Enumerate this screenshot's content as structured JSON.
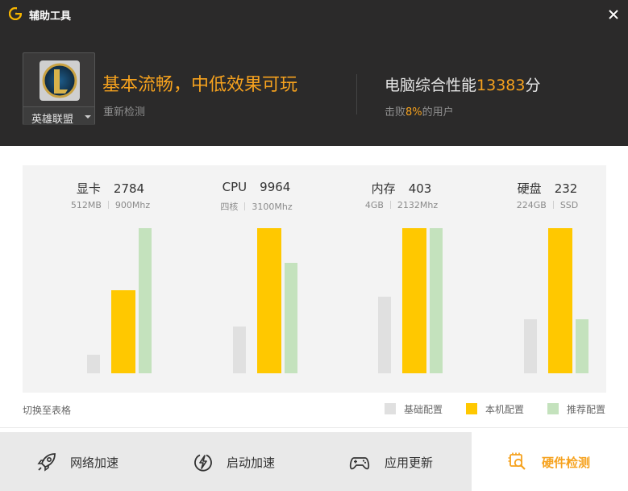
{
  "window": {
    "title": "辅助工具"
  },
  "game": {
    "name": "英雄联盟"
  },
  "summary": {
    "status": "基本流畅，中低效果可玩",
    "recheck": "重新检测",
    "score_prefix": "电脑综合性能",
    "score_value": "13383",
    "score_suffix": "分",
    "beat_prefix": "击败",
    "beat_value": "8%",
    "beat_suffix": "的用户"
  },
  "chart_data": {
    "type": "bar",
    "categories": [
      "显卡",
      "CPU",
      "内存",
      "硬盘"
    ],
    "scores": [
      "2784",
      "9964",
      "403",
      "232"
    ],
    "specs": [
      [
        "512MB",
        "900Mhz"
      ],
      [
        "四核",
        "3100Mhz"
      ],
      [
        "4GB",
        "2132Mhz"
      ],
      [
        "224GB",
        "SSD"
      ]
    ],
    "series": [
      {
        "name": "基础配置",
        "values": [
          0.13,
          0.32,
          0.53,
          0.37
        ],
        "color": "#e0e0e0"
      },
      {
        "name": "本机配置",
        "values": [
          0.57,
          1.0,
          1.0,
          1.0
        ],
        "color": "#ffc800"
      },
      {
        "name": "推荐配置",
        "values": [
          1.0,
          0.76,
          1.0,
          0.37
        ],
        "color": "#c4e2bd"
      }
    ],
    "ylim": [
      0,
      1
    ]
  },
  "controls": {
    "switch_table": "切换至表格"
  },
  "nav": [
    {
      "label": "网络加速",
      "icon": "rocket-icon"
    },
    {
      "label": "启动加速",
      "icon": "lightning-icon"
    },
    {
      "label": "应用更新",
      "icon": "gamepad-icon"
    },
    {
      "label": "硬件检测",
      "icon": "hardware-search-icon",
      "active": true
    }
  ],
  "colors": {
    "accent": "#f6a21e",
    "header_bg": "#2b2a2a"
  }
}
